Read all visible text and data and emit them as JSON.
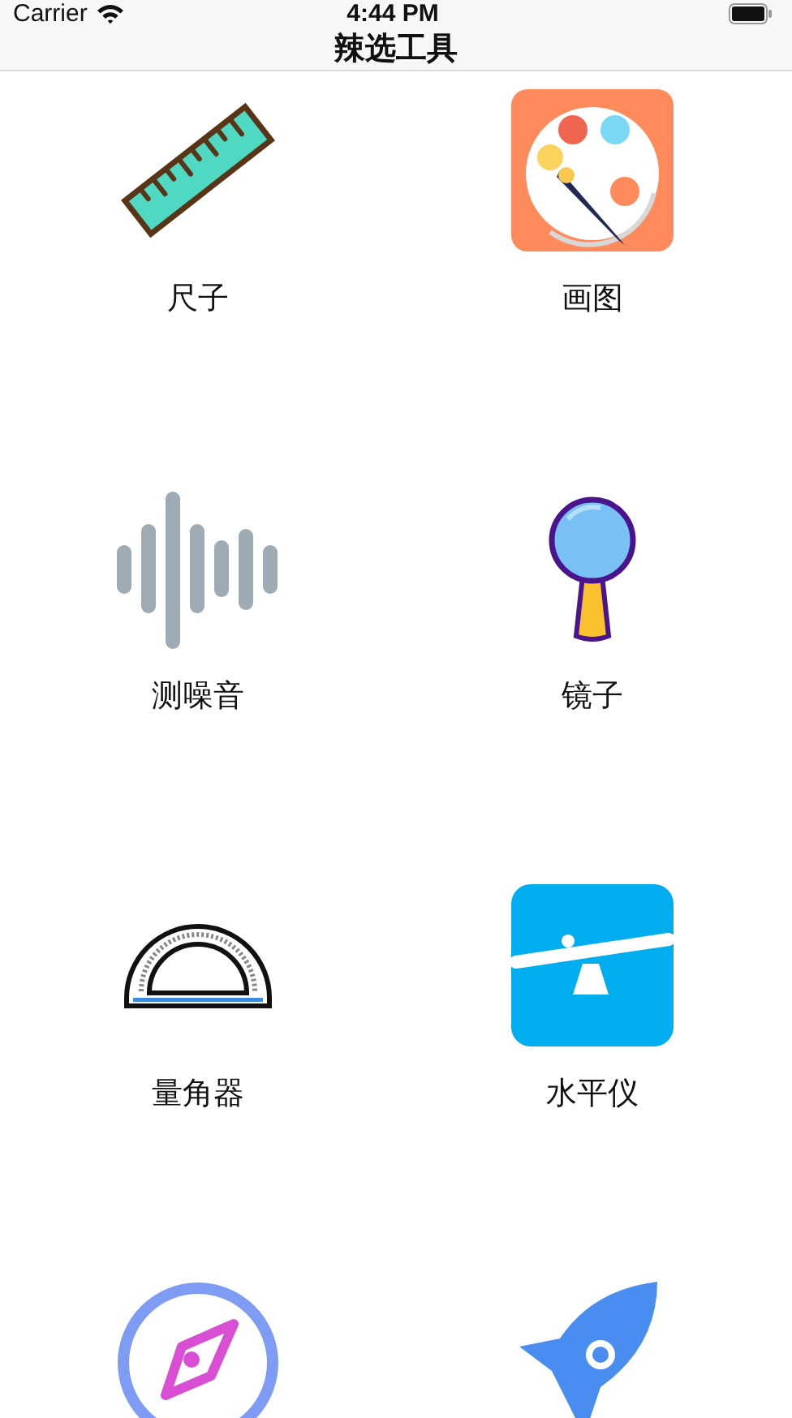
{
  "status_bar": {
    "carrier": "Carrier",
    "time": "4:44 PM"
  },
  "nav_bar": {
    "title": "辣选工具"
  },
  "tools": [
    {
      "kind": "ruler",
      "label": "尺子"
    },
    {
      "kind": "palette",
      "label": "画图"
    },
    {
      "kind": "sound",
      "label": "测噪音"
    },
    {
      "kind": "mirror",
      "label": "镜子"
    },
    {
      "kind": "protractor",
      "label": "量角器"
    },
    {
      "kind": "level",
      "label": "水平仪"
    },
    {
      "kind": "compass"
    },
    {
      "kind": "rocket"
    }
  ]
}
